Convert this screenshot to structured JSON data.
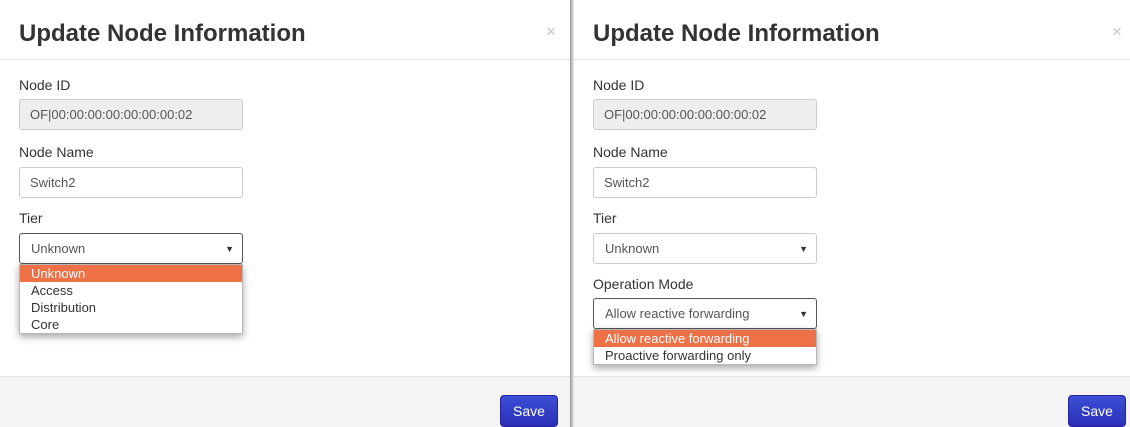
{
  "left_dialog": {
    "title": "Update Node Information",
    "close_label": "×",
    "node_id": {
      "label": "Node ID",
      "value": "OF|00:00:00:00:00:00:00:02"
    },
    "node_name": {
      "label": "Node Name",
      "value": "Switch2"
    },
    "tier": {
      "label": "Tier",
      "selected": "Unknown",
      "options": [
        "Unknown",
        "Access",
        "Distribution",
        "Core"
      ]
    },
    "save_label": "Save"
  },
  "right_dialog": {
    "title": "Update Node Information",
    "close_label": "×",
    "node_id": {
      "label": "Node ID",
      "value": "OF|00:00:00:00:00:00:00:02"
    },
    "node_name": {
      "label": "Node Name",
      "value": "Switch2"
    },
    "tier": {
      "label": "Tier",
      "selected": "Unknown"
    },
    "operation_mode": {
      "label": "Operation Mode",
      "selected": "Allow reactive forwarding",
      "options": [
        "Allow reactive forwarding",
        "Proactive forwarding only"
      ]
    },
    "save_label": "Save"
  },
  "icons": {
    "select_arrow": "▼"
  },
  "colors": {
    "highlight": "#ee7047",
    "save_button": "#2f3fc6",
    "readonly_bg": "#eeeeee",
    "footer_bg": "#f4f4f4"
  }
}
